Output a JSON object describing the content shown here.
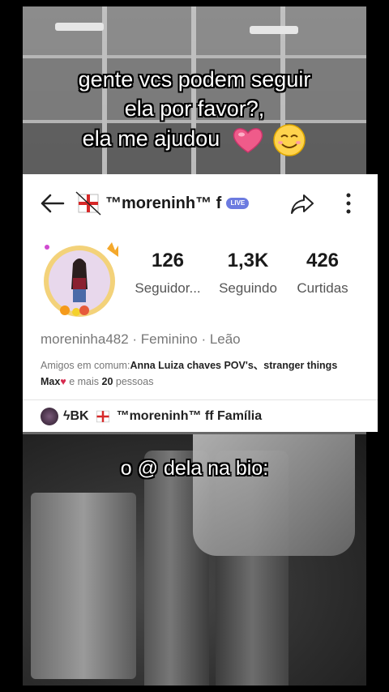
{
  "caption_top": {
    "line1": "gente vcs podem seguir",
    "line2": "ela por favor?,",
    "line3": "ela me ajudou"
  },
  "caption_bottom": "o @ dela na bio:",
  "profile": {
    "display_name": "™moreninh™ f",
    "live_badge": "LIVE",
    "stats": [
      {
        "value": "126",
        "label": "Seguidor..."
      },
      {
        "value": "1,3K",
        "label": "Seguindo"
      },
      {
        "value": "426",
        "label": "Curtidas"
      }
    ],
    "handle_info": "moreninha482 · Feminino · Leão",
    "mutual": {
      "prefix": "Amigos em comum:",
      "names": "Anna Luiza chaves POV's、stranger things Max",
      "suffix_pre": " e mais ",
      "count": "20",
      "suffix_post": " pessoas"
    },
    "family": {
      "prefix": "ϟBK",
      "name": "™moreninh™ ff Família"
    }
  },
  "colors": {
    "card_bg": "#ffffff",
    "badge": "#6c7be0",
    "text_muted": "#777777"
  },
  "icons": [
    "back-arrow-icon",
    "flag-icon",
    "share-icon",
    "more-icon",
    "heart-icon",
    "smile-icon"
  ]
}
